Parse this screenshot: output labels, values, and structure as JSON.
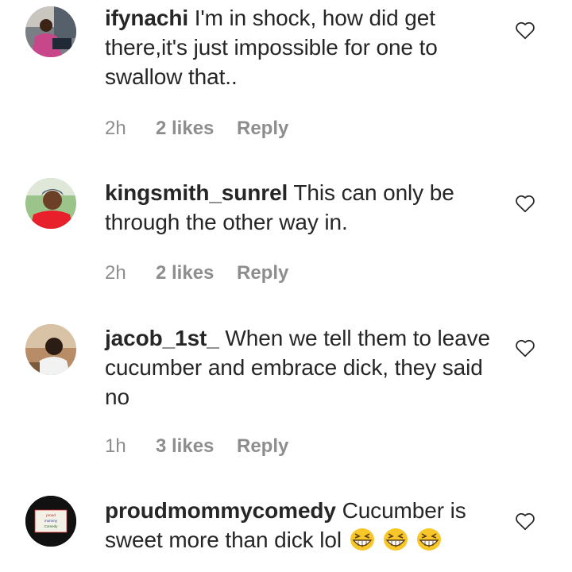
{
  "comments": [
    {
      "username": "ifynachi",
      "text": " I'm in shock, how did get there,it's just impossible for one to swallow that..",
      "time": "2h",
      "likes": "2 likes",
      "reply": "Reply"
    },
    {
      "username": "kingsmith_sunrel",
      "text": " This can only be through the other way in.",
      "time": "2h",
      "likes": "2 likes",
      "reply": "Reply"
    },
    {
      "username": "jacob_1st_",
      "text": " When we tell them to leave cucumber and embrace dick, they said no",
      "time": "1h",
      "likes": "3 likes",
      "reply": "Reply"
    },
    {
      "username": "proudmommycomedy",
      "text": " Cucumber is sweet more than dick lol",
      "emoji": [
        "grinning-squinting-face",
        "grinning-squinting-face",
        "grinning-squinting-face"
      ],
      "avatar_logo_text": "proud mommy Comedy"
    }
  ],
  "icons": {
    "like": "heart-outline-icon"
  },
  "colors": {
    "text": "#262626",
    "meta": "#8e8e8e"
  }
}
